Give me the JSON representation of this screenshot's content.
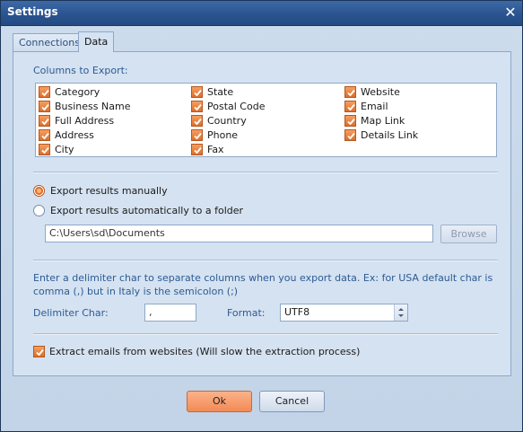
{
  "window": {
    "title": "Settings"
  },
  "tabs": [
    {
      "label": "Connections",
      "active": false
    },
    {
      "label": "Data",
      "active": true
    }
  ],
  "columns": {
    "label": "Columns to Export:",
    "items": [
      {
        "label": "Category",
        "checked": true
      },
      {
        "label": "Business Name",
        "checked": true
      },
      {
        "label": "Full Address",
        "checked": true
      },
      {
        "label": "Address",
        "checked": true
      },
      {
        "label": "City",
        "checked": true
      },
      {
        "label": "State",
        "checked": true
      },
      {
        "label": "Postal Code",
        "checked": true
      },
      {
        "label": "Country",
        "checked": true
      },
      {
        "label": "Phone",
        "checked": true
      },
      {
        "label": "Fax",
        "checked": true
      },
      {
        "label": "Website",
        "checked": true
      },
      {
        "label": "Email",
        "checked": true
      },
      {
        "label": "Map Link",
        "checked": true
      },
      {
        "label": "Details Link",
        "checked": true
      }
    ]
  },
  "export": {
    "manual_label": "Export results manually",
    "manual_selected": true,
    "auto_label": "Export results automatically to a folder",
    "auto_selected": false,
    "folder_value": "C:\\Users\\sd\\Documents",
    "browse_label": "Browse"
  },
  "delimiter": {
    "description": "Enter a delimiter char to separate columns when you export data. Ex: for USA default char is comma (,) but in Italy is the semicolon (;)",
    "char_label": "Delimiter Char:",
    "char_value": ",",
    "format_label": "Format:",
    "format_value": "UTF8"
  },
  "extract_emails": {
    "label": "Extract emails from websites (Will slow the extraction process)",
    "checked": true
  },
  "buttons": {
    "ok": "Ok",
    "cancel": "Cancel"
  },
  "colors": {
    "accent": "#e87534",
    "titlebar": "#2c5692",
    "label_blue": "#2d5b94"
  },
  "icons": {
    "close": "close-icon",
    "check": "check-icon",
    "spin": "spinner-icon"
  }
}
